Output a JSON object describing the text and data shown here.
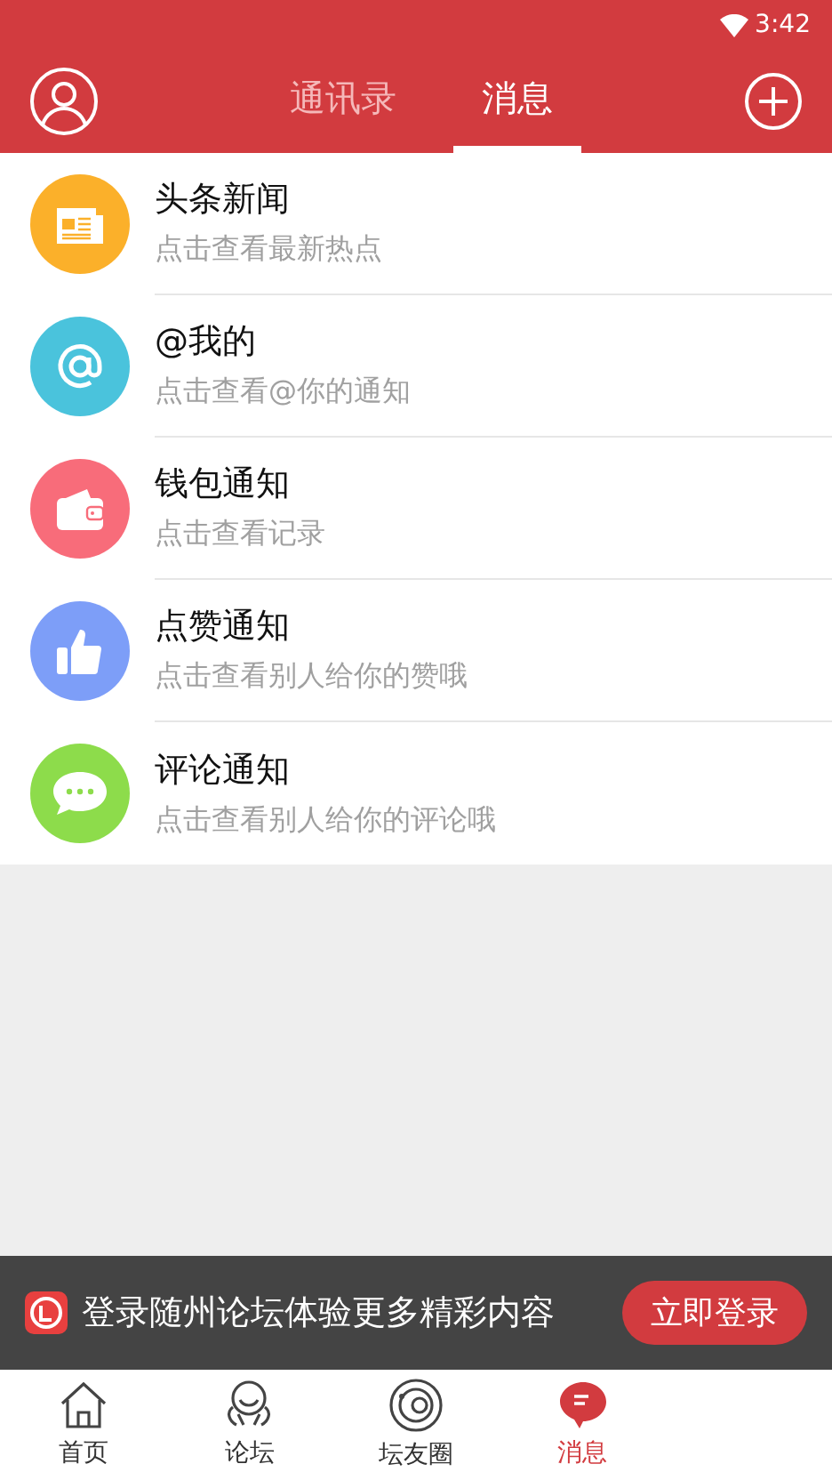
{
  "status_bar": {
    "time": "3:42"
  },
  "header": {
    "tabs": [
      {
        "label": "通讯录",
        "selected": false
      },
      {
        "label": "消息",
        "selected": true
      }
    ]
  },
  "messages": [
    {
      "kind": "news",
      "title": "头条新闻",
      "subtitle": "点击查看最新热点",
      "color": "#fbb02a"
    },
    {
      "kind": "mention",
      "title": "@我的",
      "subtitle": "点击查看@你的通知",
      "color": "#4ac3dc"
    },
    {
      "kind": "wallet",
      "title": "钱包通知",
      "subtitle": "点击查看记录",
      "color": "#f86c7a"
    },
    {
      "kind": "like",
      "title": "点赞通知",
      "subtitle": "点击查看别人给你的赞哦",
      "color": "#7d9ef8"
    },
    {
      "kind": "comment",
      "title": "评论通知",
      "subtitle": "点击查看别人给你的评论哦",
      "color": "#8ddc4b"
    }
  ],
  "login_banner": {
    "text": "登录随州论坛体验更多精彩内容",
    "button": "立即登录"
  },
  "bottom_nav": [
    {
      "kind": "home",
      "label": "首页",
      "selected": false
    },
    {
      "kind": "forum",
      "label": "论坛",
      "selected": false
    },
    {
      "kind": "circle",
      "label": "坛友圈",
      "selected": false
    },
    {
      "kind": "message",
      "label": "消息",
      "selected": true
    }
  ]
}
